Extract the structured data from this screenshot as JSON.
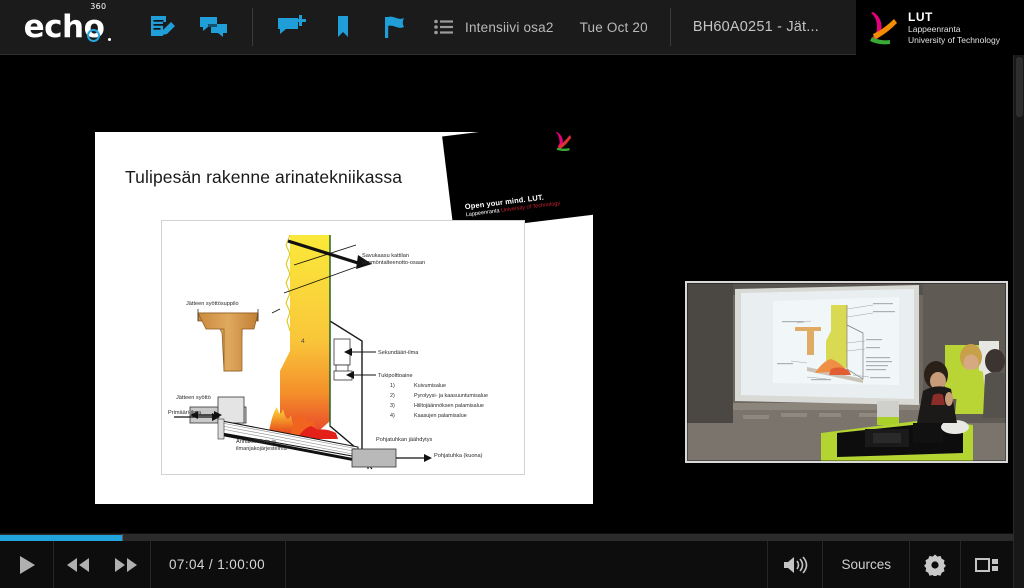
{
  "app": {
    "brand": "echo",
    "brand_sup": "360",
    "logo_icon": "echo360-logo"
  },
  "header": {
    "tools": [
      {
        "name": "notes-icon",
        "label": "Notes"
      },
      {
        "name": "discussions-icon",
        "label": "Discussions"
      },
      {
        "name": "add-comment-icon",
        "label": "Add comment"
      },
      {
        "name": "bookmark-icon",
        "label": "Bookmark"
      },
      {
        "name": "flag-icon",
        "label": "Flag"
      }
    ],
    "list_icon": "list-icon",
    "session_title": "Intensiivi osa2",
    "date": "Tue Oct 20",
    "course": "BH60A0251 - Jät...",
    "university": {
      "abbr": "LUT",
      "city": "Lappeenranta",
      "name": "University of Technology",
      "mark_colors": {
        "magenta": "#e6007e",
        "orange": "#f28c00",
        "green": "#3aaa35"
      }
    }
  },
  "slide": {
    "title": "Tulipesän rakenne arinatekniikassa",
    "banner": {
      "line1": "Open your mind. LUT.",
      "line2_black": "Lappeenranta ",
      "line2_red": "University of Technology"
    },
    "diagram": {
      "labels": {
        "flue_gas": "Savukaasu kattilan lämmöntalteenotto-osaan",
        "feed_hopper": "Jätteen syöttösuppilo",
        "feed_in": "Jätteen syöttö",
        "secondary_air": "Sekundääri-ilma",
        "support_fuel": "Tukipolttoaine",
        "primary_air": "Primääri-ilma",
        "grate_system": "Arinakoneisto ja ilmanjakojärjestelmä",
        "ash_cooling": "Pohjatuhkan jäähdytys",
        "bottom_ash": "Pohjatuhka (kuona)",
        "zone_number": "4"
      },
      "legend": [
        {
          "num": "1)",
          "text": "Kuivumisalue"
        },
        {
          "num": "2)",
          "text": "Pyrolyysi- ja kaasuuntumisalue"
        },
        {
          "num": "3)",
          "text": "Hiiltojäännöksen palamisalue"
        },
        {
          "num": "4)",
          "text": "Kaasujen palamisalue"
        }
      ]
    }
  },
  "camera": {
    "name": "lecture-room-video",
    "description": "Lecture hall with projection screen and presenters"
  },
  "player": {
    "progress_percent": 12,
    "current_time": "07:04",
    "duration": "1:00:00",
    "time_display": "07:04 / 1:00:00",
    "buttons": {
      "play": "play-button",
      "rewind": "rewind-button",
      "forward": "forward-button",
      "volume": "volume-button",
      "sources_label": "Sources",
      "settings": "settings-button",
      "layout": "layout-button"
    },
    "accent_color": "#21a4dd"
  }
}
